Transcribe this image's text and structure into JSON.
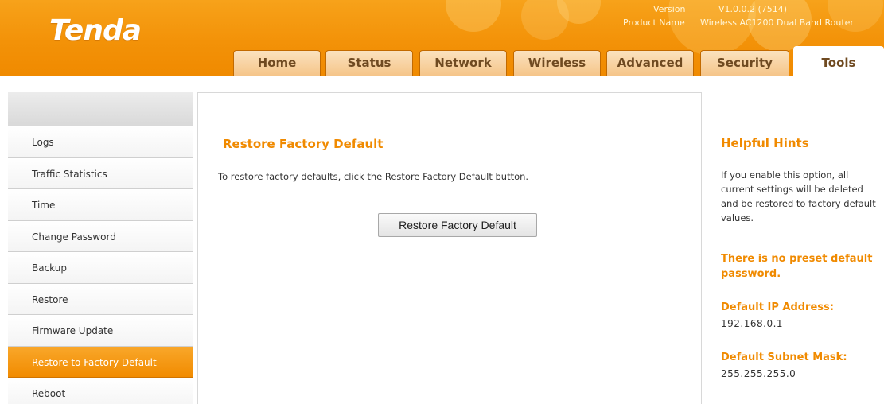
{
  "brand": {
    "logo_text": "Tenda"
  },
  "device_info": {
    "version_label": "Version",
    "version_value": "V1.0.0.2 (7514)",
    "product_label": "Product Name",
    "product_value": "Wireless AC1200 Dual Band Router"
  },
  "tabs": [
    {
      "label": "Home"
    },
    {
      "label": "Status"
    },
    {
      "label": "Network"
    },
    {
      "label": "Wireless"
    },
    {
      "label": "Advanced"
    },
    {
      "label": "Security"
    },
    {
      "label": "Tools",
      "active": true
    }
  ],
  "sidebar": {
    "items": [
      {
        "label": "Logs"
      },
      {
        "label": "Traffic Statistics"
      },
      {
        "label": "Time"
      },
      {
        "label": "Change Password"
      },
      {
        "label": "Backup"
      },
      {
        "label": "Restore"
      },
      {
        "label": "Firmware Update"
      },
      {
        "label": "Restore to Factory Default",
        "active": true
      },
      {
        "label": "Reboot"
      }
    ]
  },
  "main": {
    "title": "Restore Factory Default",
    "description": "To restore factory defaults, click the Restore Factory Default button.",
    "restore_button_label": "Restore Factory Default"
  },
  "hints": {
    "title": "Helpful Hints",
    "text": "If you enable this option, all current settings will be deleted and be restored to factory default values.",
    "warning": "There is no preset default password.",
    "ip_label": "Default IP Address:",
    "ip_value": "192.168.0.1",
    "mask_label": "Default Subnet Mask:",
    "mask_value": "255.255.255.0"
  },
  "colors": {
    "accent": "#f08a00",
    "header": "#f39208",
    "active_item": "#f18b00"
  }
}
